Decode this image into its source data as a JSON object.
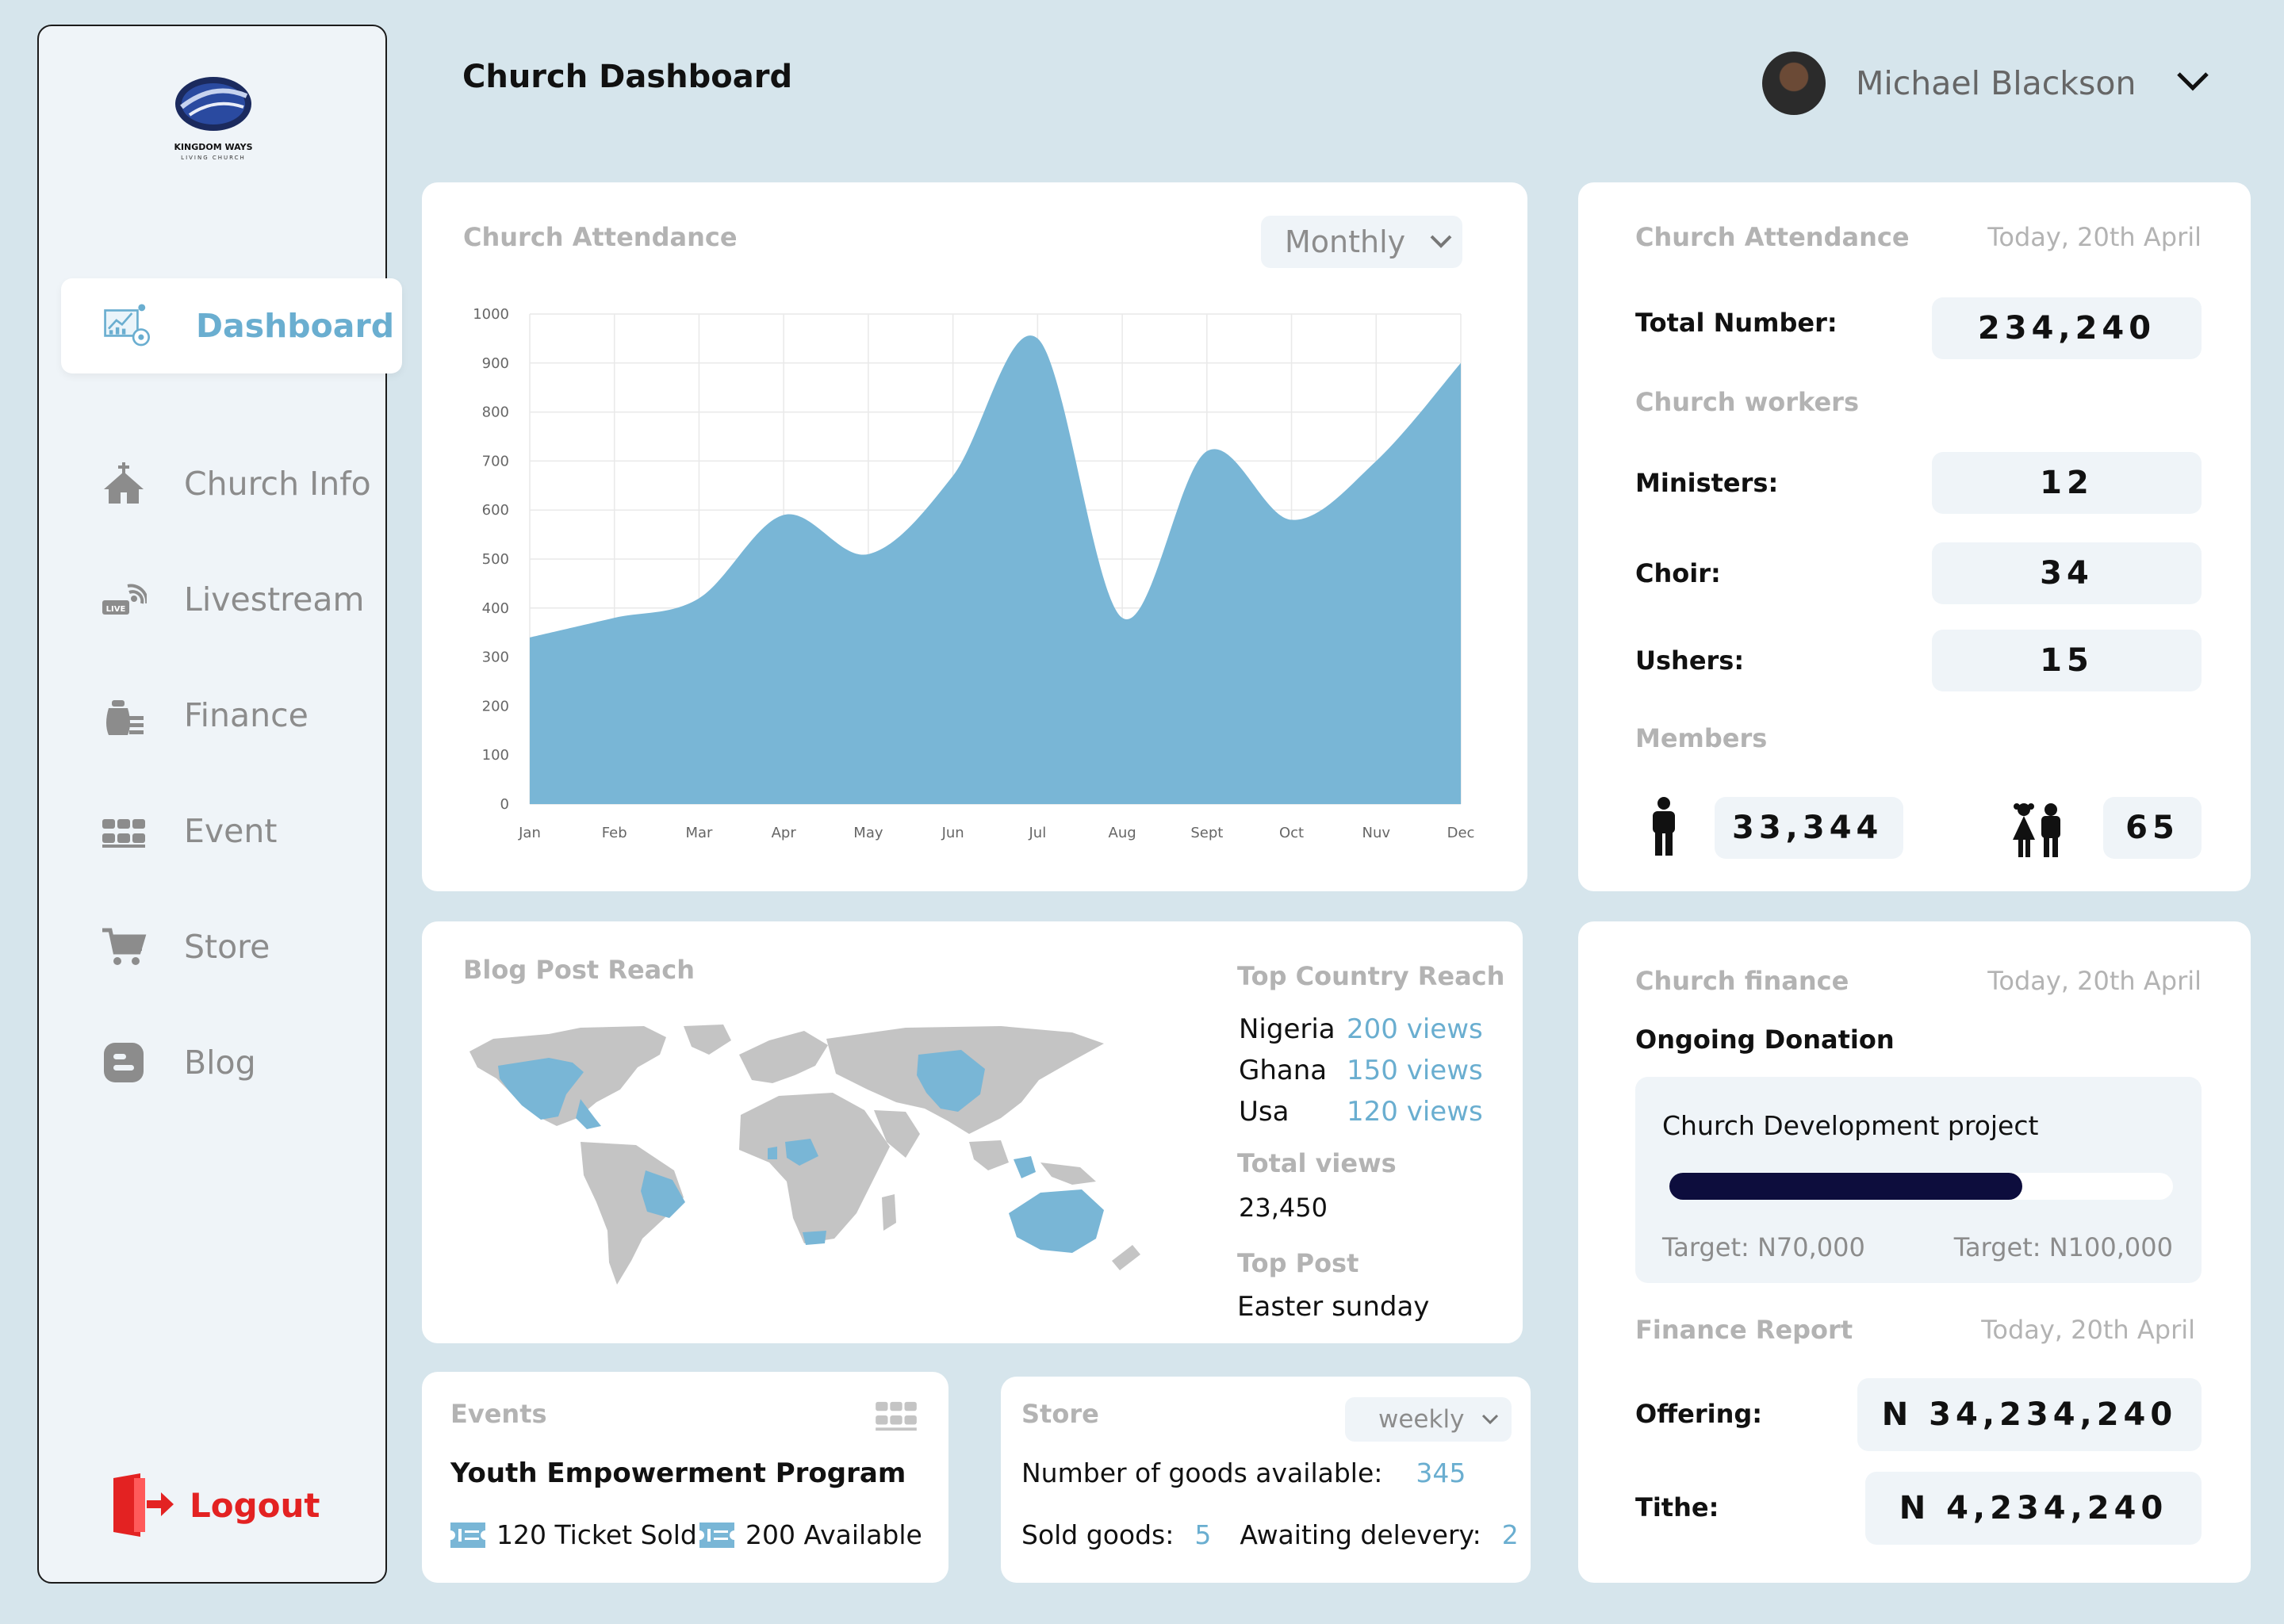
{
  "header": {
    "title": "Church Dashboard",
    "user_name": "Michael Blackson"
  },
  "sidebar": {
    "logo_text": "KINGDOM WAYS",
    "logo_subtext": "LIVING CHURCH",
    "items": [
      {
        "label": "Dashboard",
        "icon": "dashboard-analytics-icon",
        "active": true
      },
      {
        "label": "Church Info",
        "icon": "church-icon"
      },
      {
        "label": "Livestream",
        "icon": "livestream-icon"
      },
      {
        "label": "Finance",
        "icon": "money-bag-icon"
      },
      {
        "label": "Event",
        "icon": "seats-icon"
      },
      {
        "label": "Store",
        "icon": "cart-icon"
      },
      {
        "label": "Blog",
        "icon": "blog-icon"
      }
    ],
    "logout_label": "Logout"
  },
  "attendance_chart_card": {
    "label": "Church Attendance",
    "period": "Monthly"
  },
  "chart_data": {
    "type": "area",
    "categories": [
      "Jan",
      "Feb",
      "Mar",
      "Apr",
      "May",
      "Jun",
      "Jul",
      "Aug",
      "Sept",
      "Oct",
      "Nuv",
      "Dec"
    ],
    "values": [
      340,
      380,
      420,
      590,
      510,
      670,
      950,
      380,
      720,
      580,
      700,
      900
    ],
    "ylim": [
      0,
      1000
    ],
    "yticks": [
      0,
      100,
      200,
      300,
      400,
      500,
      600,
      700,
      800,
      900,
      1000
    ],
    "grid": true,
    "color": "#79b6d6"
  },
  "attendance_card": {
    "label": "Church Attendance",
    "date": "Today, 20th April",
    "total_label": "Total Number:",
    "total_value": "234,240",
    "workers_label": "Church workers",
    "ministers_label": "Ministers:",
    "ministers_value": "12",
    "choir_label": "Choir:",
    "choir_value": "34",
    "ushers_label": "Ushers:",
    "ushers_value": "15",
    "members_label": "Members",
    "adults_value": "33,344",
    "children_value": "65"
  },
  "blog_card": {
    "label": "Blog Post  Reach",
    "top_country_label": "Top Country Reach",
    "countries": [
      {
        "name": "Nigeria",
        "views": "200 views"
      },
      {
        "name": "Ghana",
        "views": "150 views"
      },
      {
        "name": "Usa",
        "views": "120 views"
      }
    ],
    "total_views_label": "Total  views",
    "total_views_value": "23,450",
    "top_post_label": "Top Post",
    "top_post_value": "Easter sunday"
  },
  "events_card": {
    "label": "Events",
    "title": "Youth Empowerment Program",
    "sold": "120 Ticket Sold",
    "available": "200 Available"
  },
  "store_card": {
    "label": "Store",
    "period": "weekly",
    "goods_label": "Number of goods available:",
    "goods_value": "345",
    "sold_label": "Sold goods:",
    "sold_value": "5",
    "awaiting_label": "Awaiting delevery:",
    "awaiting_value": "2"
  },
  "finance_card": {
    "label": "Church finance",
    "date": "Today, 20th April",
    "donation_label": "Ongoing Donation",
    "project_name": "Church Development project",
    "progress": 0.7,
    "current_target": "Target: N70,000",
    "total_target": "Target: N100,000",
    "report_label": "Finance Report",
    "report_date": "Today, 20th April",
    "offering_label": "Offering:",
    "offering_value": "N  34,234,240",
    "tithe_label": "Tithe:",
    "tithe_value": "N  4,234,240"
  },
  "colors": {
    "accent": "#6aaed0",
    "chart_fill": "#79b6d6",
    "logout": "#e32222",
    "progress": "#0d0d3d",
    "page_bg": "#d6e5ec"
  }
}
